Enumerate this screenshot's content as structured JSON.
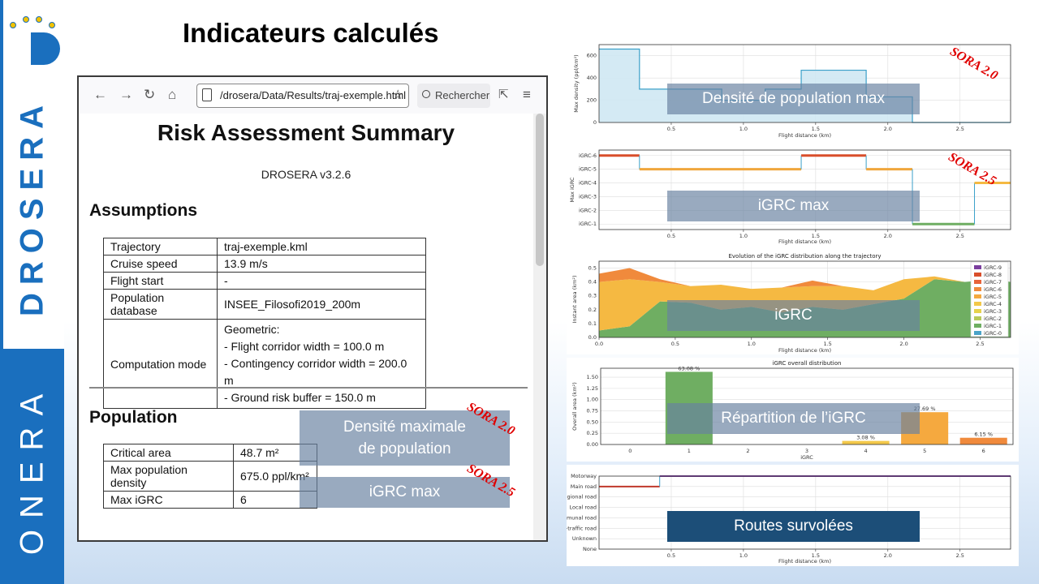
{
  "slide": {
    "title": "Indicateurs calculés",
    "brand_top": "DROSERA",
    "brand_bottom": "ONERA",
    "colors": {
      "brand_blue": "#1a6fbe",
      "overlay": "#6881a0",
      "overlay_dark": "#1c4e78",
      "sora_red": "#e00000"
    }
  },
  "browser": {
    "url": "/drosera/Data/Results/traj-exemple.html",
    "search_label": "Rechercher",
    "doc": {
      "title": "Risk Assessment Summary",
      "version": "DROSERA v3.2.6",
      "assumptions_heading": "Assumptions",
      "assumptions": [
        {
          "label": "Trajectory",
          "value": "traj-exemple.kml"
        },
        {
          "label": "Cruise speed",
          "value": "13.9 m/s"
        },
        {
          "label": "Flight start",
          "value": "-"
        },
        {
          "label": "Population database",
          "value": "INSEE_Filosofi2019_200m"
        },
        {
          "label": "Computation mode",
          "value_lines": [
            "Geometric:",
            "- Flight corridor width = 100.0 m",
            "- Contingency corridor width = 200.0 m",
            "- Ground risk buffer = 150.0 m"
          ]
        }
      ],
      "population_heading": "Population",
      "population": [
        {
          "label": "Critical area",
          "value": "48.7 m²"
        },
        {
          "label": "Max population density",
          "value": "675.0 ppl/km²"
        },
        {
          "label": "Max iGRC",
          "value": "6"
        }
      ]
    }
  },
  "overlays": {
    "density_doc": [
      "Densité maximale",
      "de population"
    ],
    "igrc_doc": "iGRC max",
    "density_chart": "Densité de population max",
    "igrc_chart": "iGRC max",
    "igrc_evolution": "iGRC",
    "igrc_distribution": "Répartition de l’iGRC",
    "roads": "Routes survolées",
    "sora20": "SORA 2.0",
    "sora25": "SORA 2.5"
  },
  "charts": {
    "density": {
      "type": "area",
      "ylabel": "Max density (ppl/km²)",
      "xlabel": "Flight distance (km)",
      "x_ticks": [
        "0.5",
        "1.0",
        "1.5",
        "2.0",
        "2.5"
      ],
      "y_ticks": [
        "0",
        "200",
        "400",
        "600"
      ],
      "xlim": [
        0,
        2.85
      ],
      "ylim": [
        0,
        700
      ],
      "steps": [
        [
          0,
          660
        ],
        [
          0.28,
          660
        ],
        [
          0.28,
          300
        ],
        [
          0.85,
          300
        ],
        [
          0.85,
          200
        ],
        [
          1.15,
          200
        ],
        [
          1.15,
          300
        ],
        [
          1.4,
          300
        ],
        [
          1.4,
          470
        ],
        [
          1.85,
          470
        ],
        [
          1.85,
          230
        ],
        [
          2.17,
          230
        ],
        [
          2.17,
          0
        ],
        [
          2.85,
          0
        ]
      ]
    },
    "igrc_max": {
      "type": "line",
      "ylabel": "Max iGRC",
      "xlabel": "Flight distance (km)",
      "x_ticks": [
        "0.5",
        "1.0",
        "1.5",
        "2.0",
        "2.5"
      ],
      "y_ticks": [
        "iGRC-1",
        "iGRC-2",
        "iGRC-3",
        "iGRC-4",
        "iGRC-5",
        "iGRC-6"
      ],
      "xlim": [
        0,
        2.85
      ],
      "ylim": [
        0.6,
        6.4
      ],
      "steps": [
        [
          0,
          6
        ],
        [
          0.28,
          6
        ],
        [
          0.28,
          5
        ],
        [
          1.4,
          5
        ],
        [
          1.4,
          6
        ],
        [
          1.85,
          6
        ],
        [
          1.85,
          5
        ],
        [
          2.17,
          5
        ],
        [
          2.17,
          1
        ],
        [
          2.6,
          1
        ],
        [
          2.6,
          4
        ],
        [
          2.85,
          4
        ]
      ]
    },
    "evolution": {
      "type": "area",
      "title": "Evolution of the iGRC distribution along the trajectory",
      "ylabel": "Instant area (km²)",
      "xlabel": "Flight distance (km)",
      "x_ticks": [
        "0.0",
        "0.5",
        "1.0",
        "1.5",
        "2.0",
        "2.5"
      ],
      "y_ticks": [
        "0.0",
        "0.1",
        "0.2",
        "0.3",
        "0.4",
        "0.5"
      ],
      "xlim": [
        0,
        2.7
      ],
      "ylim": [
        0,
        0.55
      ],
      "legend": [
        "iGRC-9",
        "iGRC-8",
        "iGRC-7",
        "iGRC-6",
        "iGRC-5",
        "iGRC-4",
        "iGRC-3",
        "iGRC-2",
        "iGRC-1",
        "iGRC-0"
      ],
      "legend_colors": [
        "#7b3f9e",
        "#d94e2b",
        "#e8633a",
        "#f08a3c",
        "#f5a93f",
        "#f3c84a",
        "#e7d24c",
        "#b8c95a",
        "#6fae62",
        "#4aa3c8"
      ],
      "x": [
        0,
        0.2,
        0.4,
        0.6,
        0.8,
        1.0,
        1.2,
        1.4,
        1.6,
        1.8,
        2.0,
        2.2,
        2.4,
        2.6,
        2.7
      ],
      "igrc1": [
        0.05,
        0.08,
        0.26,
        0.25,
        0.2,
        0.22,
        0.18,
        0.22,
        0.2,
        0.24,
        0.28,
        0.42,
        0.4,
        0.42,
        0.4
      ],
      "igrc5": [
        0.35,
        0.34,
        0.14,
        0.12,
        0.18,
        0.13,
        0.18,
        0.15,
        0.17,
        0.1,
        0.14,
        0.02,
        0.0,
        0.0,
        0.0
      ],
      "igrc6": [
        0.06,
        0.08,
        0.02,
        0.0,
        0.0,
        0.0,
        0.0,
        0.04,
        0.0,
        0.0,
        0.0,
        0.0,
        0.0,
        0.0,
        0.0
      ]
    },
    "distribution": {
      "type": "bar",
      "title": "iGRC overall distribution",
      "ylabel": "Overall area (km²)",
      "xlabel": "iGRC",
      "categories": [
        "0",
        "1",
        "2",
        "3",
        "4",
        "5",
        "6"
      ],
      "values": [
        0,
        1.62,
        0,
        0,
        0.08,
        0.72,
        0.15
      ],
      "labels": [
        "",
        "63.08 %",
        "",
        "",
        "3.08 %",
        "27.69 %",
        "6.15 %"
      ],
      "colors": [
        "#4aa3c8",
        "#6fae62",
        "#b8c95a",
        "#e7d24c",
        "#f3c84a",
        "#f5a93f",
        "#f08a3c"
      ],
      "y_ticks": [
        "0.00",
        "0.25",
        "0.50",
        "0.75",
        "1.00",
        "1.25",
        "1.50"
      ],
      "ylim": [
        0,
        1.7
      ]
    },
    "roads": {
      "type": "line",
      "xlabel": "Flight distance (km)",
      "x_ticks": [
        "0.5",
        "1.0",
        "1.5",
        "2.0",
        "2.5"
      ],
      "y_ticks": [
        "None",
        "Unknown",
        "-traffic road",
        "munal road",
        "Local road",
        "gional road",
        "Main road",
        "Motorway"
      ],
      "xlim": [
        0,
        2.85
      ],
      "steps": [
        [
          0,
          6
        ],
        [
          0.42,
          6
        ],
        [
          0.42,
          7
        ],
        [
          2.85,
          7
        ]
      ]
    }
  }
}
